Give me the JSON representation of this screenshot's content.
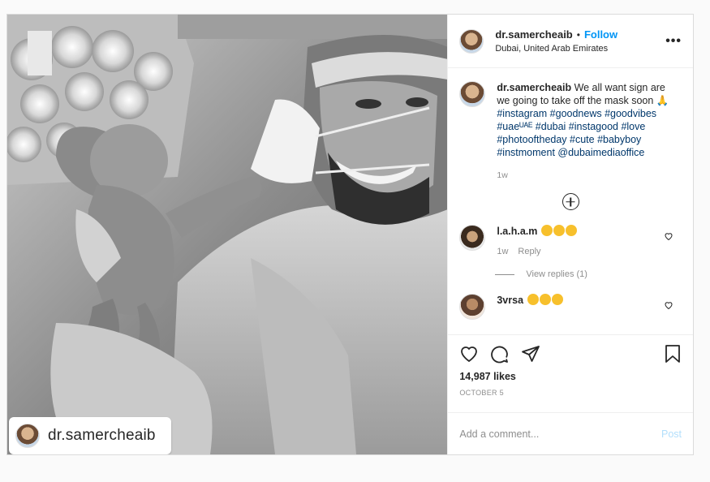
{
  "author": {
    "username": "dr.samercheaib",
    "follow_label": "Follow",
    "dot": "•",
    "location": "Dubai, United Arab Emirates"
  },
  "photo_tag": {
    "username": "dr.samercheaib"
  },
  "caption": {
    "username": "dr.samercheaib",
    "text": "We all want sign are we going to take off the mask soon 🙏",
    "hashtags": "#instagram #goodnews #goodvibes #uaeᵁᴬᴱ #dubai #instagood #love #photooftheday #cute #babyboy #instmoment @dubaimediaoffice",
    "age": "1w"
  },
  "comments": [
    {
      "username": "l.a.h.a.m",
      "emoji_count": 3,
      "age": "1w",
      "reply_label": "Reply"
    },
    {
      "username": "3vrsa",
      "emoji_count": 3
    }
  ],
  "view_replies_label": "View replies (1)",
  "likes": "14,987 likes",
  "date": "OCTOBER 5",
  "add_comment_placeholder": "Add a comment...",
  "post_label": "Post",
  "more_icon": "•••",
  "colors": {
    "link": "#0095f6",
    "tag": "#00376b",
    "muted": "#8e8e8e"
  }
}
